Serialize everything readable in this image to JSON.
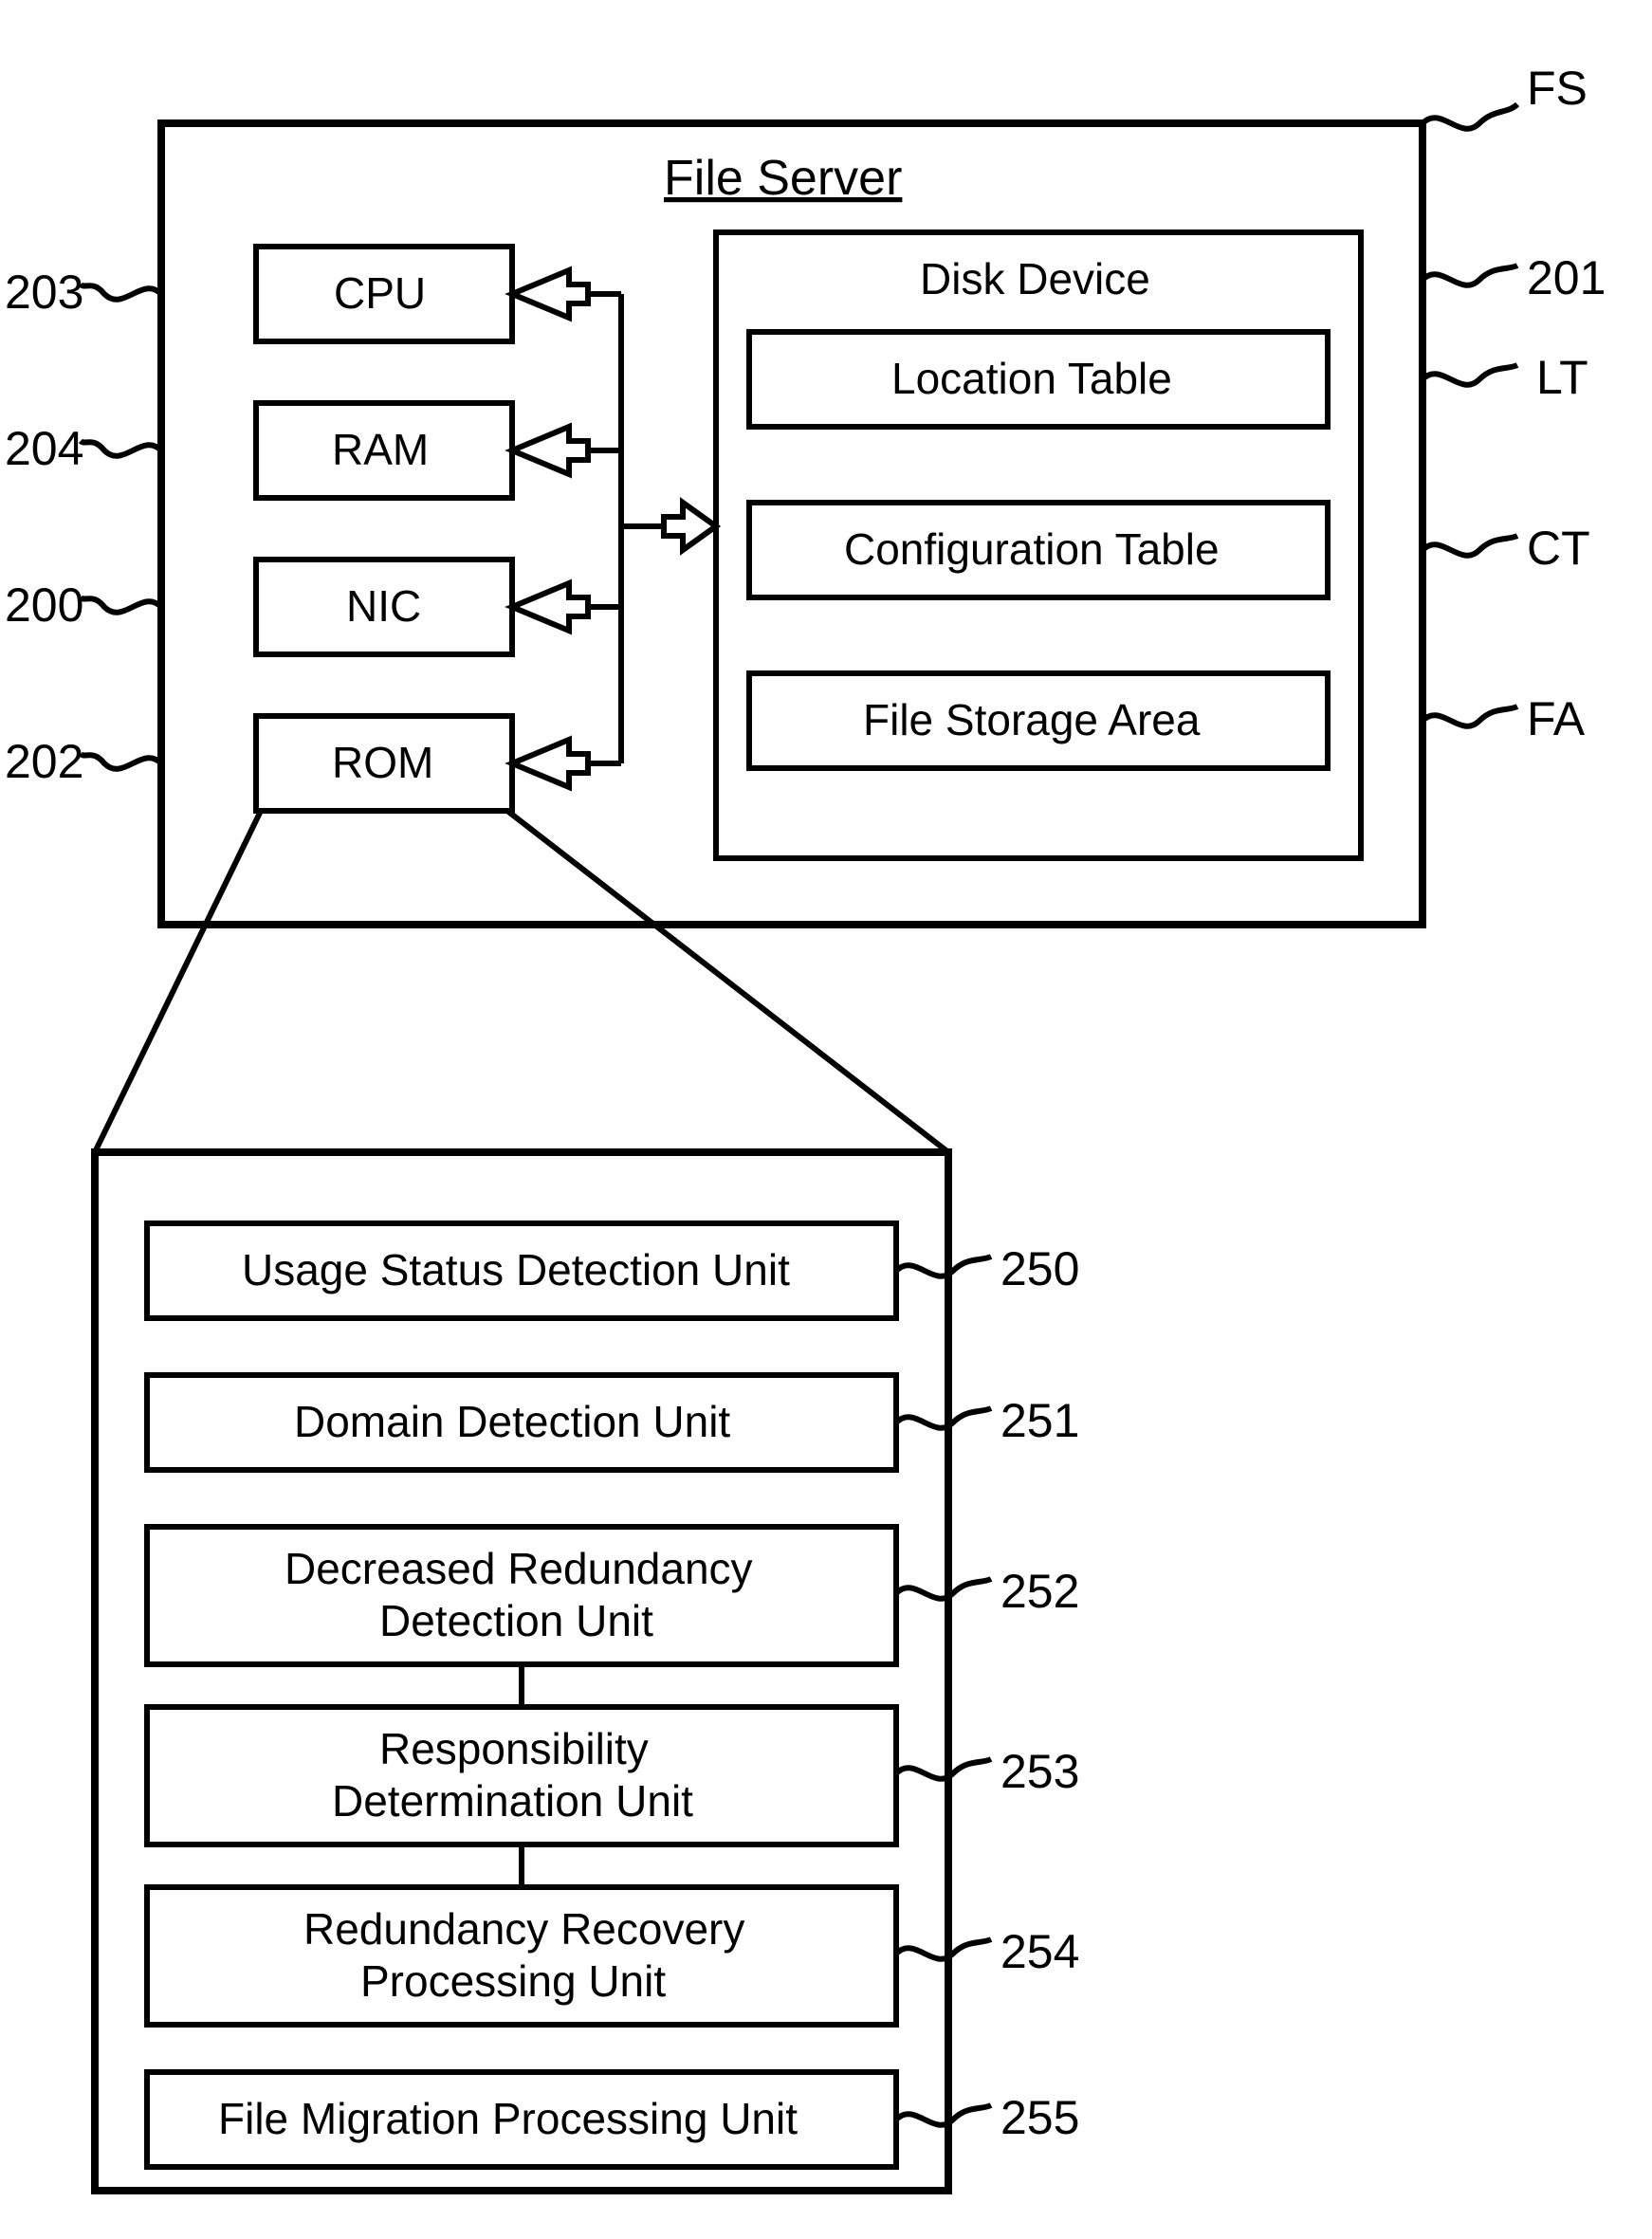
{
  "fileServer": {
    "title": "File Server",
    "labelFS": "FS",
    "cpu": {
      "label": "CPU",
      "ref": "203"
    },
    "ram": {
      "label": "RAM",
      "ref": "204"
    },
    "nic": {
      "label": "NIC",
      "ref": "200"
    },
    "rom": {
      "label": "ROM",
      "ref": "202"
    },
    "diskDevice": {
      "title": "Disk Device",
      "ref": "201",
      "locationTable": {
        "label": "Location Table",
        "ref": "LT"
      },
      "configurationTable": {
        "label": "Configuration Table",
        "ref": "CT"
      },
      "fileStorageArea": {
        "label": "File Storage Area",
        "ref": "FA"
      }
    }
  },
  "romDetail": {
    "usageStatus": {
      "label": "Usage Status Detection Unit",
      "ref": "250"
    },
    "domainDetection": {
      "label": "Domain Detection Unit",
      "ref": "251"
    },
    "decreasedRedundancy": {
      "line1": "Decreased Redundancy",
      "line2": "Detection Unit",
      "ref": "252"
    },
    "responsibility": {
      "line1": "Responsibility",
      "line2": "Determination Unit",
      "ref": "253"
    },
    "redundancyRecovery": {
      "line1": "Redundancy Recovery",
      "line2": "Processing Unit",
      "ref": "254"
    },
    "fileMigration": {
      "label": "File Migration Processing Unit",
      "ref": "255"
    }
  }
}
